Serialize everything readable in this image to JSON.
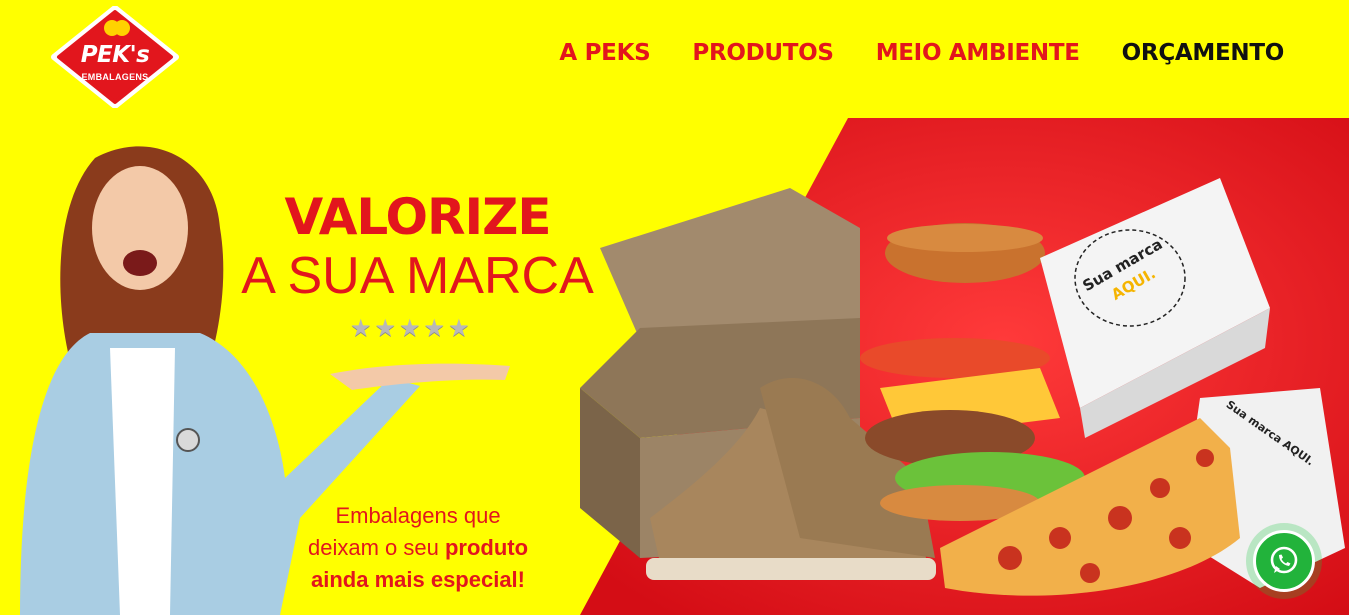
{
  "brand": {
    "name": "PEK's",
    "tagline": "EMBALAGENS",
    "colors": {
      "primary_red": "#e2161d",
      "yellow": "#ffff00",
      "black": "#111111"
    }
  },
  "nav": {
    "items": [
      {
        "label": "A PEKS"
      },
      {
        "label": "PRODUTOS"
      },
      {
        "label": "MEIO AMBIENTE"
      },
      {
        "label": "ORÇAMENTO"
      }
    ]
  },
  "hero": {
    "headline_line1": "VALORIZE",
    "headline_line2": "A SUA MARCA",
    "rating_stars": 5,
    "tagline_plain_1": "Embalagens que",
    "tagline_plain_2": "deixam o seu ",
    "tagline_bold_1": "produto",
    "tagline_bold_2": "ainda mais especial!",
    "box_print_text": "Sua marca AQUI."
  },
  "whatsapp": {
    "icon": "whatsapp-icon"
  }
}
